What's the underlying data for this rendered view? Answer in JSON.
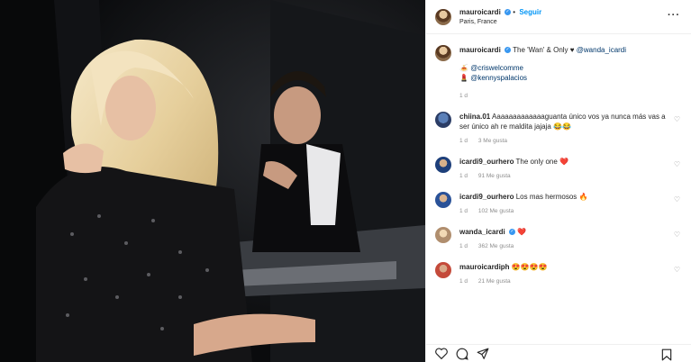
{
  "header": {
    "username": "mauroicardi",
    "follow_label": "Seguir",
    "location": "Paris, France",
    "more_label": "···"
  },
  "caption": {
    "username": "mauroicardi",
    "text": "The 'Wan' & Only ♥",
    "mention": "@wanda_icardi",
    "line2_emoji": "🍝",
    "line2_mention": "@criswelcomme",
    "line3_emoji": "💄",
    "line3_mention": "@kennyspalacios",
    "age": "1 d"
  },
  "comments": [
    {
      "username": "chiina.01",
      "text": "Aaaaaaaaaaaaaguanta único vos ya nunca más vas a ser único ah re maldita jajaja 😂😂",
      "age": "1 d",
      "likes": "3 Me gusta"
    },
    {
      "username": "icardi9_ourhero",
      "text": "The only one ❤️",
      "age": "1 d",
      "likes": "91 Me gusta"
    },
    {
      "username": "icardi9_ourhero",
      "text": "Los mas hermosos 🔥",
      "age": "1 d",
      "likes": "102 Me gusta"
    },
    {
      "username": "wanda_icardi",
      "text": "❤️",
      "age": "1 d",
      "likes": "362 Me gusta"
    },
    {
      "username": "mauroicardiph",
      "text": "😍😍😍😍",
      "age": "1 d",
      "likes": "21 Me gusta"
    }
  ],
  "icons": [
    "heart-icon",
    "comment-icon",
    "share-icon",
    "bookmark-icon",
    "verified-icon"
  ],
  "colors": {
    "link": "#00376b",
    "follow": "#0095f6",
    "verified": "#3897f0",
    "muted": "#8e8e8e"
  }
}
